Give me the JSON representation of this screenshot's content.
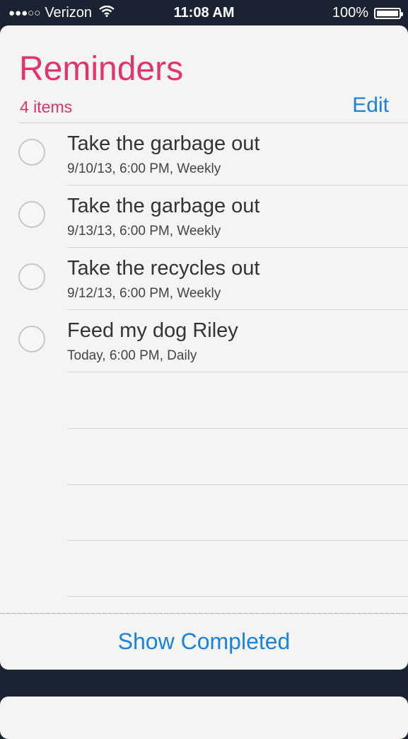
{
  "status_bar": {
    "signal": "●●●○○",
    "carrier": "Verizon",
    "time": "11:08 AM",
    "battery": "100%",
    "battery_level": 1.0
  },
  "list": {
    "title": "Reminders",
    "count_label": "4 items",
    "edit_label": "Edit",
    "accent_color": "#e3336e",
    "link_color": "#1a82e0"
  },
  "items": [
    {
      "title": "Take the garbage out",
      "subtitle": "9/10/13, 6:00 PM, Weekly"
    },
    {
      "title": "Take the garbage out",
      "subtitle": "9/13/13, 6:00 PM, Weekly"
    },
    {
      "title": "Take the recycles out",
      "subtitle": "9/12/13, 6:00 PM, Weekly"
    },
    {
      "title": "Feed my dog Riley",
      "subtitle": "Today, 6:00 PM, Daily"
    }
  ],
  "footer": {
    "show_completed_label": "Show Completed"
  },
  "icons": {
    "wifi": "wifi-icon",
    "battery": "battery-icon",
    "checkbox": "empty-circle-checkbox"
  }
}
